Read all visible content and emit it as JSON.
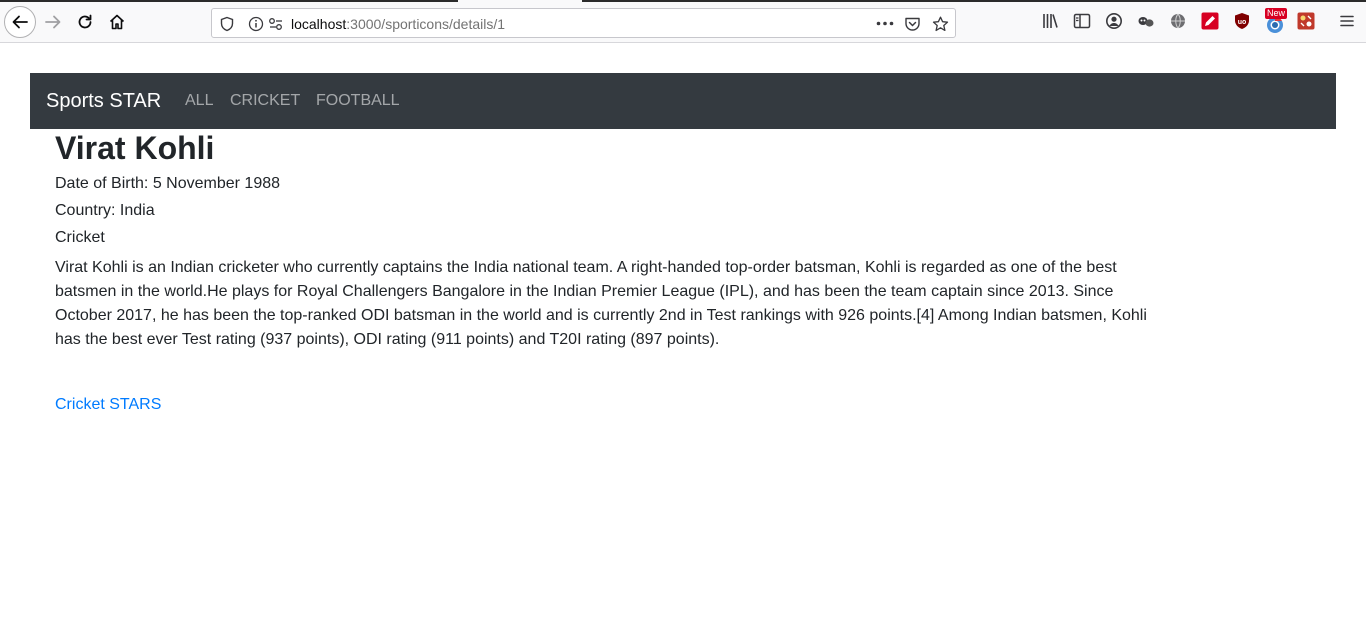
{
  "browser": {
    "url_host": "localhost",
    "url_path": ":3000/sporticons/details/1",
    "more_icon": "ellipsis-icon"
  },
  "navbar": {
    "brand": "Sports STAR",
    "links": [
      "ALL",
      "CRICKET",
      "FOOTBALL"
    ]
  },
  "player": {
    "name": "Virat Kohli",
    "dob": "Date of Birth: 5 November 1988",
    "country": "Country: India",
    "sport": "Cricket",
    "bio": "Virat Kohli is an Indian cricketer who currently captains the India national team. A right-handed top-order batsman, Kohli is regarded as one of the best batsmen in the world.He plays for Royal Challengers Bangalore in the Indian Premier League (IPL), and has been the team captain since 2013. Since October 2017, he has been the top-ranked ODI batsman in the world and is currently 2nd in Test rankings with 926 points.[4] Among Indian batsmen, Kohli has the best ever Test rating (937 points), ODI rating (911 points) and T20I rating (897 points)."
  },
  "footer_link": "Cricket STARS",
  "extension_badge": "New",
  "colors": {
    "navbar_bg": "#343a40",
    "link": "#007bff",
    "text": "#212529"
  }
}
